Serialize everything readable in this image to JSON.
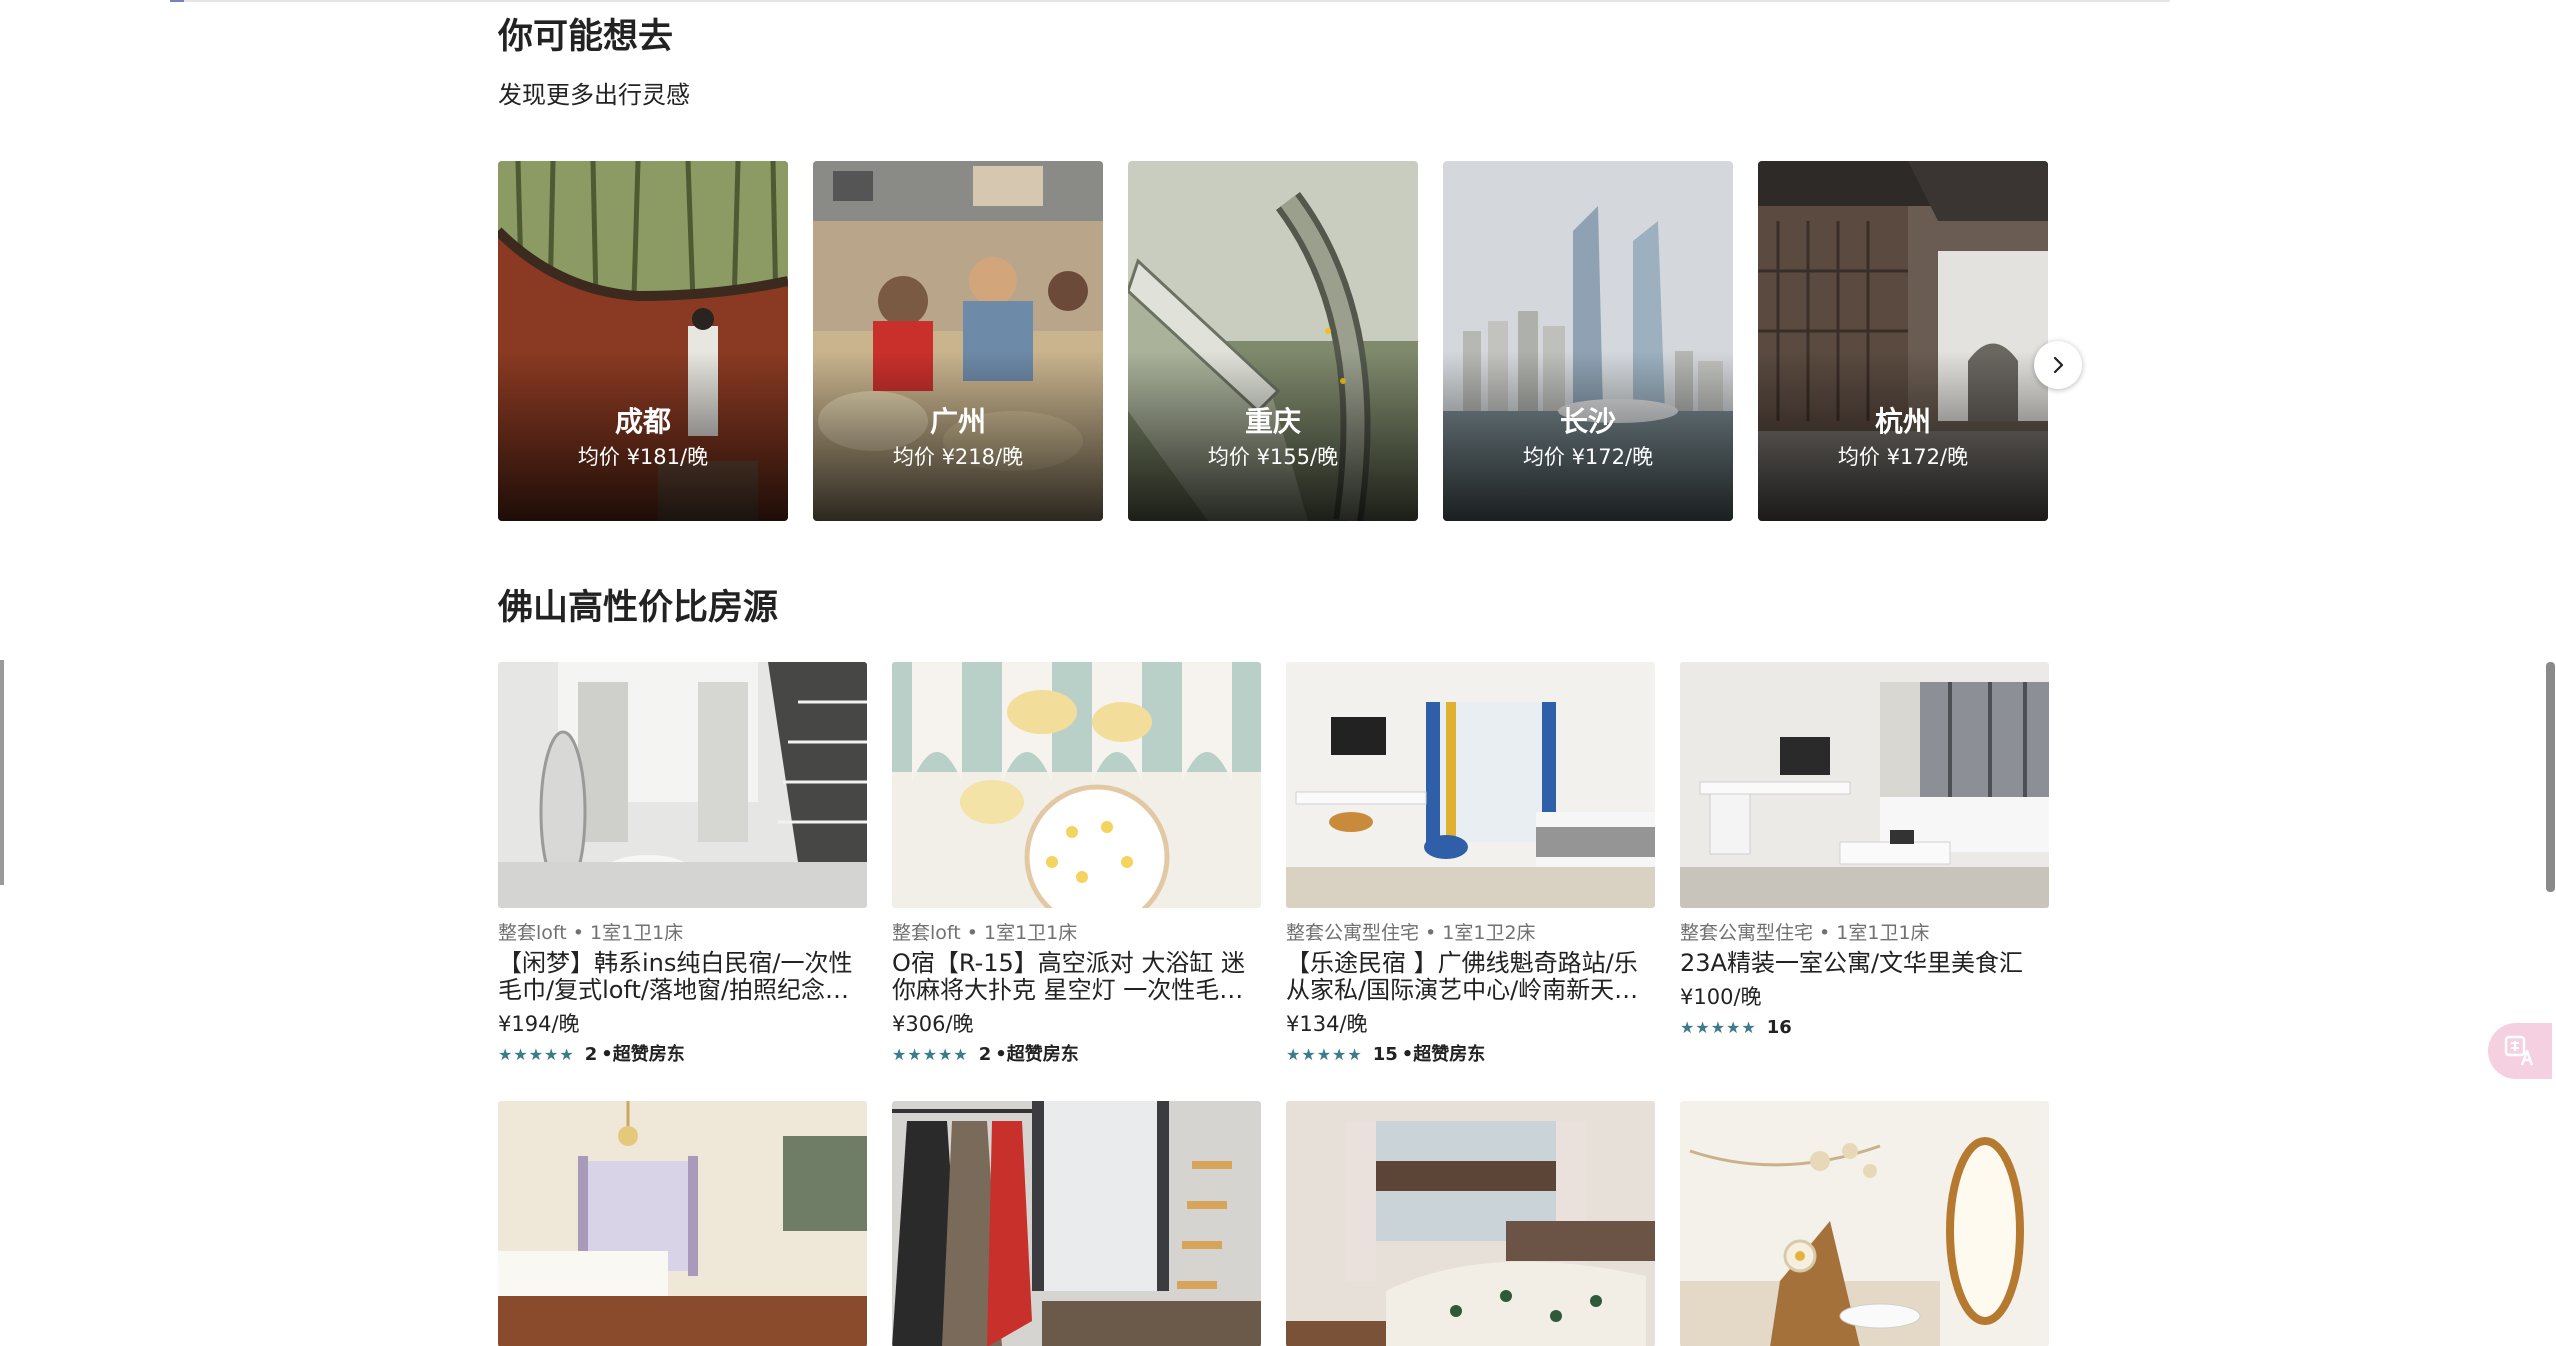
{
  "inspire": {
    "title": "你可能想去",
    "subtitle": "发现更多出行灵感",
    "destinations": [
      {
        "name": "成都",
        "price": "均价 ¥181/晚"
      },
      {
        "name": "广州",
        "price": "均价 ¥218/晚"
      },
      {
        "name": "重庆",
        "price": "均价 ¥155/晚"
      },
      {
        "name": "长沙",
        "price": "均价 ¥172/晚"
      },
      {
        "name": "杭州",
        "price": "均价 ¥172/晚"
      }
    ],
    "next_icon": "chevron-right-icon"
  },
  "listings": {
    "title": "佛山高性价比房源",
    "items": [
      {
        "type": "整套loft • 1室1卫1床",
        "title": "【闲梦】韩系ins纯白民宿/一次性毛巾/复式loft/落地窗/拍照纪念日…",
        "price": "¥194/晚",
        "stars": "★★★★★",
        "reviews": "2",
        "host_tag": "•超赞房东"
      },
      {
        "type": "整套loft • 1室1卫1床",
        "title": "O宿【R-15】高空派对 大浴缸 迷你麻将大扑克 星空灯 一次性毛…",
        "price": "¥306/晚",
        "stars": "★★★★★",
        "reviews": "2",
        "host_tag": "•超赞房东"
      },
      {
        "type": "整套公寓型住宅 • 1室1卫2床",
        "title": "【乐途民宿 】广佛线魁奇路站/乐从家私/国际演艺中心/岭南新天…",
        "price": "¥134/晚",
        "stars": "★★★★★",
        "reviews": "15",
        "host_tag": "•超赞房东"
      },
      {
        "type": "整套公寓型住宅 • 1室1卫1床",
        "title": "23A精装一室公寓/文华里美食汇",
        "price": "¥100/晚",
        "stars": "★★★★★",
        "reviews": "16",
        "host_tag": ""
      }
    ]
  },
  "widgets": {
    "translate_icon": "translate-icon"
  }
}
